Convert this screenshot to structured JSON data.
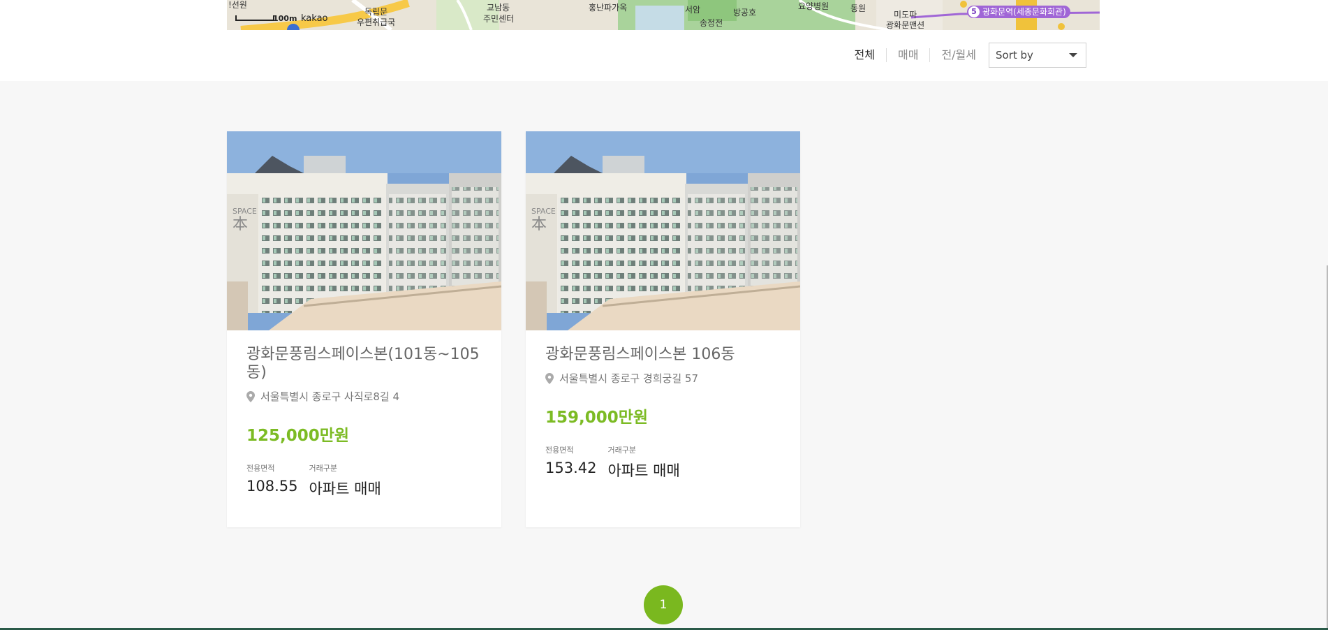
{
  "map": {
    "labels": [
      "!선원",
      "독립문",
      "우편취급국",
      "교남동",
      "주민센터",
      "홍난파가옥",
      "서암",
      "송정전",
      "방공호",
      "요양병원",
      "동원",
      "미도파",
      "광화문맨션"
    ],
    "scale": "100m",
    "brand": "kakao",
    "station_num": "5",
    "station": "광화문역(세종문화회관)"
  },
  "filters": {
    "tabs": [
      "전체",
      "매매",
      "전/월세"
    ],
    "active": "전체",
    "sort_label": "Sort by"
  },
  "listings": [
    {
      "title": "광화문풍림스페이스본(101동~105동)",
      "address": "서울특별시 종로구 사직로8길 4",
      "price": "125,000만원",
      "area_label": "전용면적",
      "area": "108.55",
      "type_label": "거래구분",
      "type": "아파트 매매"
    },
    {
      "title": "광화문풍림스페이스본 106동",
      "address": "서울특별시 종로구 경희궁길 57",
      "price": "159,000만원",
      "area_label": "전용면적",
      "area": "153.42",
      "type_label": "거래구분",
      "type": "아파트 매매"
    }
  ],
  "pagination": {
    "current": "1"
  },
  "colors": {
    "accent": "#7cbb24",
    "pager": "#7ab81f",
    "station": "#a066d6"
  }
}
